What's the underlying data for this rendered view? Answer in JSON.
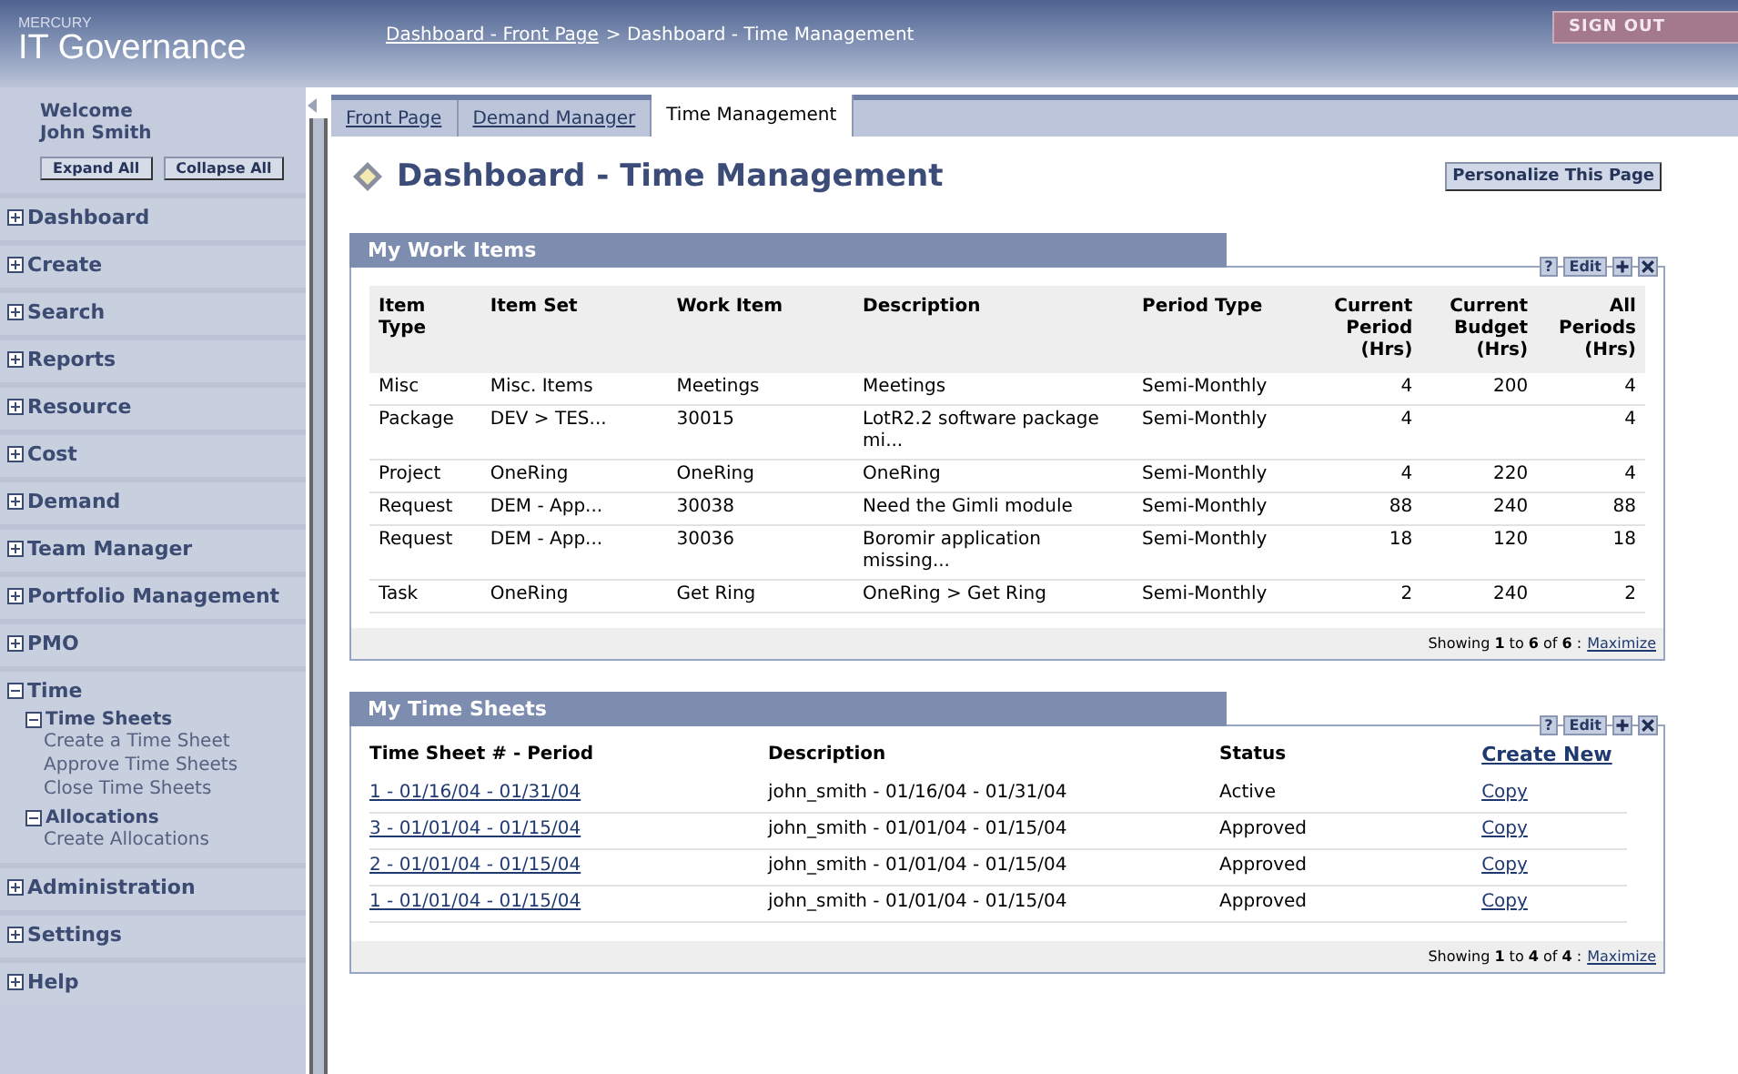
{
  "header": {
    "brand_small": "MERCURY",
    "brand": "IT Governance",
    "breadcrumb_link": "Dashboard - Front Page",
    "breadcrumb_rest": "> Dashboard - Time Management",
    "sign_out": "SIGN OUT"
  },
  "sidebar": {
    "welcome": "Welcome",
    "user": "John Smith",
    "buttons": [
      "Expand All",
      "Collapse All"
    ],
    "items": [
      {
        "label": "Dashboard",
        "expanded": false
      },
      {
        "label": "Create",
        "expanded": false
      },
      {
        "label": "Search",
        "expanded": false
      },
      {
        "label": "Reports",
        "expanded": false
      },
      {
        "label": "Resource",
        "expanded": false
      },
      {
        "label": "Cost",
        "expanded": false
      },
      {
        "label": "Demand",
        "expanded": false
      },
      {
        "label": "Team Manager",
        "expanded": false
      },
      {
        "label": "Portfolio Management",
        "expanded": false
      },
      {
        "label": "PMO",
        "expanded": false
      },
      {
        "label": "Time",
        "expanded": true,
        "children": [
          {
            "label": "Time Sheets",
            "expanded": true,
            "children": [
              {
                "label": "Create a Time Sheet"
              },
              {
                "label": "Approve Time Sheets"
              },
              {
                "label": "Close Time Sheets"
              }
            ]
          },
          {
            "label": "Allocations",
            "expanded": true,
            "children": [
              {
                "label": "Create Allocations"
              }
            ]
          }
        ]
      },
      {
        "label": "Administration",
        "expanded": false
      },
      {
        "label": "Settings",
        "expanded": false
      },
      {
        "label": "Help",
        "expanded": false
      }
    ]
  },
  "tabs": [
    {
      "label": "Front Page",
      "selected": false
    },
    {
      "label": "Demand Manager",
      "selected": false
    },
    {
      "label": "Time Management",
      "selected": true
    }
  ],
  "page_title": "Dashboard - Time Management",
  "personalize": "Personalize This Page",
  "portlets": [
    {
      "title": "My Work Items",
      "tools": [
        "?",
        "Edit"
      ],
      "kind": "work",
      "columns": [
        {
          "label": "Item Type",
          "kind": "text"
        },
        {
          "label": "Item Set",
          "kind": "text"
        },
        {
          "label": "Work Item",
          "kind": "text"
        },
        {
          "label": "Description",
          "kind": "text"
        },
        {
          "label": "Period Type",
          "kind": "text"
        },
        {
          "label": "Current Period (Hrs)",
          "kind": "number"
        },
        {
          "label": "Current Budget (Hrs)",
          "kind": "number"
        },
        {
          "label": "All Periods (Hrs)",
          "kind": "number"
        }
      ],
      "rows": [
        [
          "Misc",
          "Misc. Items",
          "Meetings",
          "Meetings",
          "Semi-Monthly",
          "4",
          "200",
          "4"
        ],
        [
          "Package",
          "DEV > TES...",
          "30015",
          "LotR2.2 software package mi...",
          "Semi-Monthly",
          "4",
          "",
          "4"
        ],
        [
          "Project",
          "OneRing",
          "OneRing",
          "OneRing",
          "Semi-Monthly",
          "4",
          "220",
          "4"
        ],
        [
          "Request",
          "DEM - App...",
          "30038",
          "Need the Gimli module",
          "Semi-Monthly",
          "88",
          "240",
          "88"
        ],
        [
          "Request",
          "DEM - App...",
          "30036",
          "Boromir application missing...",
          "Semi-Monthly",
          "18",
          "120",
          "18"
        ],
        [
          "Task",
          "OneRing",
          "Get Ring",
          "OneRing > Get Ring",
          "Semi-Monthly",
          "2",
          "240",
          "2"
        ]
      ],
      "footer": "Showing **1** to **6** of **6** :",
      "footer_link": "Maximize"
    },
    {
      "title": "My Time Sheets",
      "tools": [
        "?",
        "Edit"
      ],
      "kind": "sheets",
      "columns": [
        {
          "label": "Time Sheet # - Period",
          "kind": "text"
        },
        {
          "label": "Description",
          "kind": "text"
        },
        {
          "label": "Status",
          "kind": "text"
        },
        {
          "label": "Create New",
          "kind": "link"
        }
      ],
      "rows": [
        [
          "1 - 01/16/04 - 01/31/04",
          "john_smith - 01/16/04 - 01/31/04",
          "Active",
          "Copy"
        ],
        [
          "3 - 01/01/04 - 01/15/04",
          "john_smith - 01/01/04 - 01/15/04",
          "Approved",
          "Copy"
        ],
        [
          "2 - 01/01/04 - 01/15/04",
          "john_smith - 01/01/04 - 01/15/04",
          "Approved",
          "Copy"
        ],
        [
          "1 - 01/01/04 - 01/15/04",
          "john_smith - 01/01/04 - 01/15/04",
          "Approved",
          "Copy"
        ]
      ],
      "footer": "Showing **1** to **4** of **4** :",
      "footer_link": "Maximize"
    }
  ]
}
